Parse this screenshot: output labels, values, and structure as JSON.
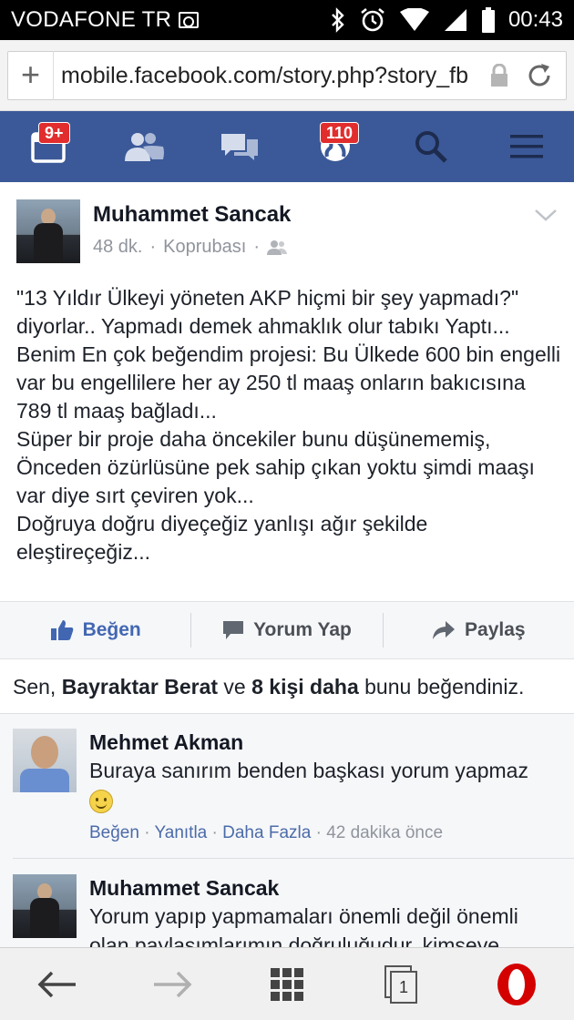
{
  "status_bar": {
    "carrier": "VODAFONE TR",
    "time": "00:43"
  },
  "browser": {
    "url": "mobile.facebook.com/story.php?story_fb",
    "tab_count": "1"
  },
  "fb_nav": {
    "requests_badge": "9+",
    "notifications_badge": "110",
    "accent_color": "#3b5998"
  },
  "post": {
    "author": "Muhammet Sancak",
    "time": "48 dk.",
    "location": "Koprubası",
    "meta_separator": "·",
    "text": "\"13 Yıldır Ülkeyi yöneten AKP hiçmi bir şey yapmadı?\" diyorlar.. Yapmadı demek ahmaklık olur tabıkı Yaptı... Benim En çok beğendim projesi: Bu Ülkede 600 bin engelli var bu engellilere her ay 250 tl maaş onların bakıcısına 789 tl maaş bağladı...\nSüper bir proje daha öncekiler bunu düşünememiş, Önceden özürlüsüne pek sahip çıkan yoktu şimdi maaşı var diye sırt çeviren yok...\nDoğruya doğru diyeçeğiz yanlışı ağır şekilde eleştireçeğiz..."
  },
  "actions": {
    "like": "Beğen",
    "comment": "Yorum Yap",
    "share": "Paylaş"
  },
  "likes_summary": {
    "prefix": "Sen, ",
    "name": "Bayraktar Berat",
    "middle": " ve ",
    "others": "8 kişi daha",
    "suffix": " bunu beğendiniz."
  },
  "comments": [
    {
      "author": "Mehmet Akman",
      "text": "Buraya sanırım benden başkası yorum yapmaz",
      "like": "Beğen",
      "reply": "Yanıtla",
      "more": "Daha Fazla",
      "time": "42 dakika önce",
      "sep": " · "
    },
    {
      "author": "Muhammet Sancak",
      "text": "Yorum yapıp yapmamaları önemli değil önemli olan paylaşımlarımın doğruluğudur. kimseye"
    }
  ]
}
